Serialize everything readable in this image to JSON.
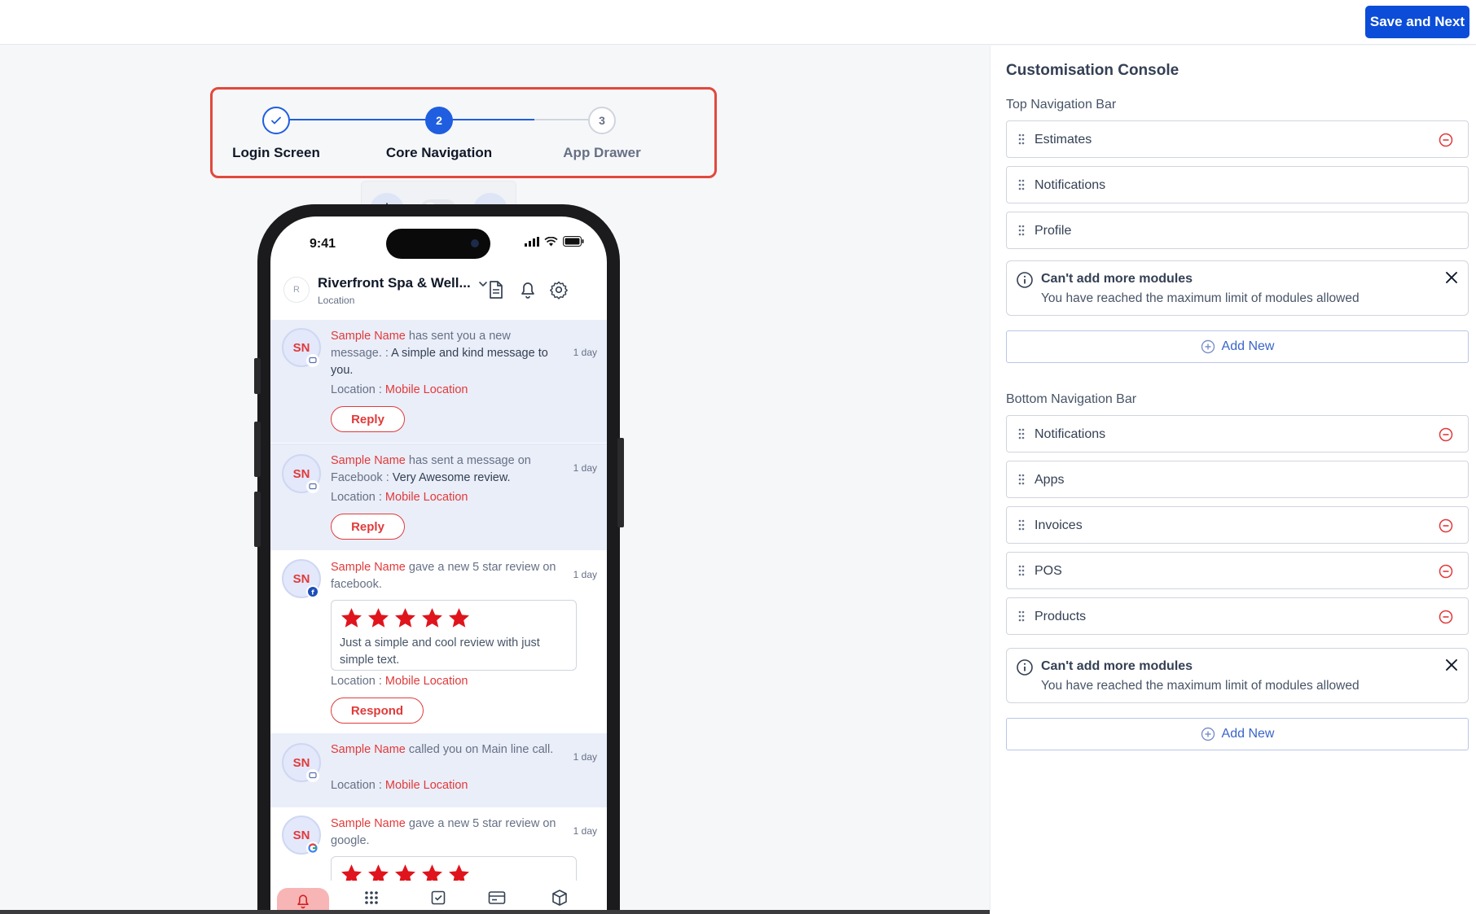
{
  "toolbar": {
    "save_next_label": "Save and Next"
  },
  "stepper": {
    "steps": [
      {
        "number": "",
        "label": "Login Screen",
        "state": "completed"
      },
      {
        "number": "2",
        "label": "Core Navigation",
        "state": "active"
      },
      {
        "number": "3",
        "label": "App Drawer",
        "state": "upcoming"
      }
    ]
  },
  "theme": {
    "light_icon": "sun-icon",
    "dark_icon": "moon-icon",
    "dark_mode_on": false
  },
  "phone": {
    "status": {
      "time": "9:41"
    },
    "header": {
      "avatar_initial": "R",
      "location_name": "Riverfront Spa & Well...",
      "location_label": "Location"
    },
    "notifications": [
      {
        "initials": "SN",
        "name": "Sample Name",
        "action": " has sent you a new message. : ",
        "message": "A simple and kind message to you.",
        "time": "1 day",
        "location_prefix": "Location : ",
        "location_value": "Mobile Location",
        "button": "Reply",
        "badge": "chat-icon"
      },
      {
        "initials": "SN",
        "name": "Sample Name",
        "action": " has sent a message on Facebook : ",
        "message": "Very Awesome review.",
        "time": "1 day",
        "location_prefix": "Location : ",
        "location_value": "Mobile Location",
        "button": "Reply",
        "badge": "chat-icon"
      },
      {
        "initials": "SN",
        "name": "Sample Name",
        "action": " gave a new 5 star review on facebook.",
        "time": "1 day",
        "rating": 5,
        "review": "Just a simple and cool review with just simple text.",
        "location_prefix": "Location : ",
        "location_value": "Mobile Location",
        "button": "Respond",
        "badge": "facebook-icon"
      },
      {
        "initials": "SN",
        "name": "Sample Name",
        "action": " called you on Main line call.",
        "time": "1 day",
        "location_prefix": "Location : ",
        "location_value": "Mobile Location",
        "badge": "chat-icon"
      },
      {
        "initials": "SN",
        "name": "Sample Name",
        "action": " gave a new 5 star review on google.",
        "time": "1 day",
        "rating": 5,
        "badge": "google-icon"
      }
    ],
    "tabbar": [
      "bell-icon",
      "apps-grid-icon",
      "task-check-icon",
      "invoice-icon",
      "box-icon"
    ]
  },
  "console": {
    "title": "Customisation Console",
    "top_nav": {
      "label": "Top Navigation Bar",
      "items": [
        "Estimates",
        "Notifications",
        "Profile"
      ],
      "alert_title": "Can't add more modules",
      "alert_message": "You have reached the maximum limit of modules allowed",
      "add_label": "Add New"
    },
    "bottom_nav": {
      "label": "Bottom Navigation Bar",
      "items": [
        "Notifications",
        "Apps",
        "Invoices",
        "POS",
        "Products"
      ],
      "alert_title": "Can't add more modules",
      "alert_message": "You have reached the maximum limit of modules allowed",
      "add_label": "Add New"
    }
  },
  "colors": {
    "brand_blue": "#0b4dd8",
    "step_blue": "#1f5ee0",
    "accent_red": "#e13a3a",
    "highlight_row": "#eaeef9"
  }
}
